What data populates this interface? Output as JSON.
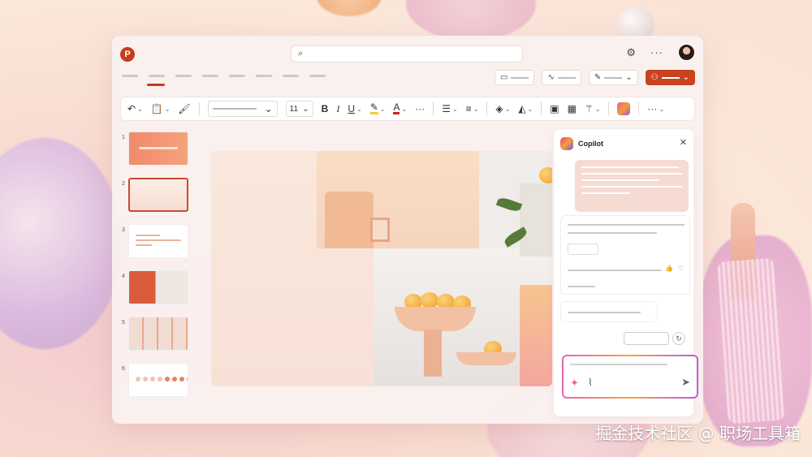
{
  "window": {
    "app_icon_letter": "P",
    "search": {
      "placeholder": ""
    }
  },
  "header": {
    "copilot_title": "Copilot"
  },
  "ribbon": {
    "font_size": "11",
    "bold": "B",
    "italic": "I",
    "underline": "U",
    "font_color": "A"
  },
  "slides": [
    "1",
    "2",
    "3",
    "4",
    "5",
    "6"
  ],
  "selected_slide": 2,
  "colors": {
    "accent": "#c43e1c",
    "share_button": "#c9431f"
  },
  "icons": [
    "search-icon",
    "gear-icon",
    "more-icon",
    "comment-icon",
    "activity-icon",
    "pen-icon",
    "share-icon",
    "undo-icon",
    "paste-icon",
    "format-painter-icon",
    "highlight-icon",
    "bullets-icon",
    "align-icon",
    "shapes-icon",
    "fill-icon",
    "designer-icon",
    "copilot-icon",
    "close-icon",
    "sparkle-icon",
    "attach-icon",
    "send-icon",
    "refresh-icon"
  ],
  "watermark": "掘金技术社区 @ 职场工具箱"
}
